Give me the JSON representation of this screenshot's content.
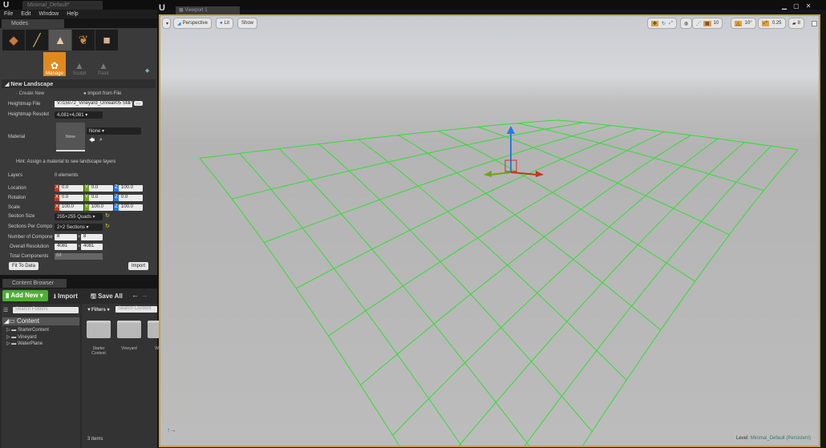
{
  "app": {
    "doc_tab": "Minimal_Default*",
    "menu": [
      "File",
      "Edit",
      "Window",
      "Help"
    ]
  },
  "modes": {
    "tab": "Modes",
    "tools": [
      "Manage",
      "Sculpt",
      "Paint"
    ],
    "section": "New Landscape",
    "create_new": "Create New",
    "import_from_file": "Import from File",
    "heightmap_file_label": "Heightmap File",
    "heightmap_file": "V:/15072_Vineyard_Unreal/05 Still/",
    "browse": "...",
    "heightmap_res_label": "Heightmap Resolut",
    "heightmap_res": "4,081×4,081",
    "material_label": "Material",
    "material_thumb": "None",
    "material_value": "None",
    "hint": "Hint: Assign a material to see landscape layers",
    "layers_label": "Layers",
    "layers_value": "0 elements",
    "location_label": "Location",
    "location": [
      "0.0",
      "0.0",
      "100.0"
    ],
    "rotation_label": "Rotation",
    "rotation": [
      "0.0",
      "0.0",
      "0.0"
    ],
    "scale_label": "Scale",
    "scale": [
      "100.0",
      "100.0",
      "100.0"
    ],
    "axes": [
      "X",
      "Y",
      "Z"
    ],
    "section_size_label": "Section Size",
    "section_size": "255×255 Quads",
    "sections_per_label": "Sections Per Compo",
    "sections_per": "2×2 Sections",
    "num_components_label": "Number of Compone",
    "num_components": [
      "8",
      "8"
    ],
    "overall_res_label": "Overall Resolution",
    "overall_res": [
      "4081",
      "4081"
    ],
    "times": "×",
    "total_components_label": "Total Components",
    "total_components": "64",
    "fit_to_data": "Fit To Data",
    "import": "Import"
  },
  "content_browser": {
    "tab": "Content Browser",
    "add_new": "Add New",
    "import": "Import",
    "save_all": "Save All",
    "search_folders": "Search Folders",
    "filters": "Filters",
    "search_content": "Search Content",
    "root": "Content",
    "folders": [
      "StarterContent",
      "Vineyard",
      "WaterPlane"
    ],
    "assets": [
      "Starter Content",
      "Vineyard",
      "Wate"
    ],
    "count": "3 items"
  },
  "viewport": {
    "tab": "Viewport 1",
    "perspective": "Perspective",
    "lit": "Lit",
    "show": "Show",
    "grid_snap": "10",
    "rot_snap": "10°",
    "scale_snap": "0.25",
    "camera_speed": "8",
    "level_label": "Level:",
    "level": "Minimal_Default (Persistent)"
  },
  "colors": {
    "grid": "#33dd33",
    "accent": "#e09a2a",
    "x": "#c8361e",
    "y": "#6ca61c",
    "z": "#2a7ae0"
  }
}
